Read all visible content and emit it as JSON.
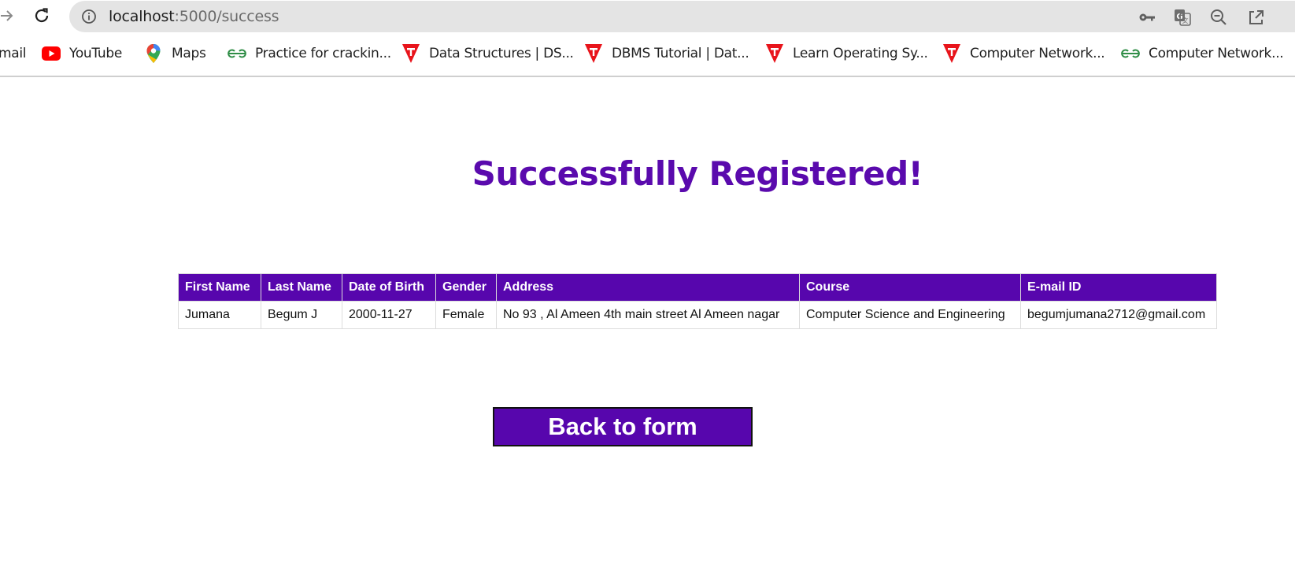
{
  "browser": {
    "url_host": "localhost",
    "url_rest": ":5000/success",
    "bookmarks": [
      {
        "label": "mail",
        "icon": "gmail-icon"
      },
      {
        "label": "YouTube",
        "icon": "youtube-icon"
      },
      {
        "label": "Maps",
        "icon": "maps-icon"
      },
      {
        "label": "Practice for crackin...",
        "icon": "geeksforgeeks-icon"
      },
      {
        "label": "Data Structures | DS...",
        "icon": "tutorialspoint-icon"
      },
      {
        "label": "DBMS Tutorial | Dat...",
        "icon": "tutorialspoint-icon"
      },
      {
        "label": "Learn Operating Sy...",
        "icon": "tutorialspoint-icon"
      },
      {
        "label": "Computer Network...",
        "icon": "tutorialspoint-icon"
      },
      {
        "label": "Computer Network...",
        "icon": "geeksforgeeks-icon"
      }
    ]
  },
  "page": {
    "title": "Successfully Registered!",
    "table": {
      "headers": [
        "First Name",
        "Last Name",
        "Date of Birth",
        "Gender",
        "Address",
        "Course",
        "E-mail ID"
      ],
      "rows": [
        [
          "Jumana",
          "Begum J",
          "2000-11-27",
          "Female",
          "No 93 , Al Ameen 4th main street Al Ameen nagar",
          "Computer Science and Engineering",
          "begumjumana2712@gmail.com"
        ]
      ]
    },
    "back_button": "Back to form"
  },
  "colors": {
    "accent": "#5706ad",
    "title": "#5a0aad"
  }
}
